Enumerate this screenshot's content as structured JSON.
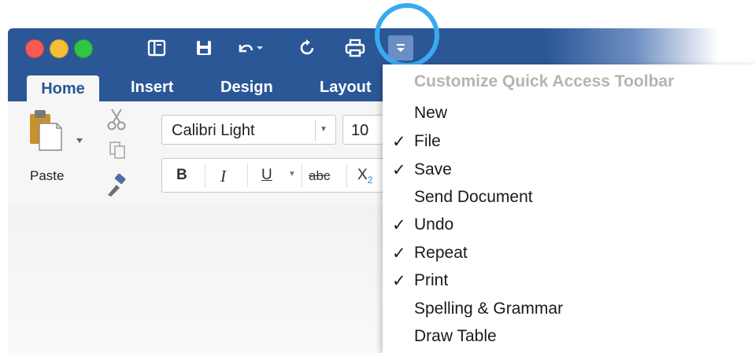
{
  "tabs": [
    "Home",
    "Insert",
    "Design",
    "Layout"
  ],
  "ribbon": {
    "paste_label": "Paste",
    "font_name": "Calibri Light",
    "font_size": "10",
    "format_buttons": {
      "bold": "B",
      "italic": "I",
      "underline": "U",
      "strikethrough": "abc",
      "subscript": "X",
      "subscript_digit": "2"
    }
  },
  "qat_icons": [
    "sidebar-icon",
    "save-icon",
    "undo-icon",
    "repeat-icon",
    "print-icon",
    "customize-dropdown-icon"
  ],
  "menu": {
    "header": "Customize Quick Access Toolbar",
    "items": [
      {
        "label": "New",
        "checked": ""
      },
      {
        "label": "File",
        "checked": "✓"
      },
      {
        "label": "Save",
        "checked": "✓"
      },
      {
        "label": "Send Document",
        "checked": ""
      },
      {
        "label": "Undo",
        "checked": "✓"
      },
      {
        "label": "Repeat",
        "checked": "✓"
      },
      {
        "label": "Print",
        "checked": "✓"
      },
      {
        "label": "Spelling & Grammar",
        "checked": ""
      },
      {
        "label": "Draw Table",
        "checked": ""
      }
    ]
  },
  "colors": {
    "title_bar": "#2b5797",
    "highlight_ring": "#3aaaf0",
    "menu_header": "#b4b4b4"
  }
}
